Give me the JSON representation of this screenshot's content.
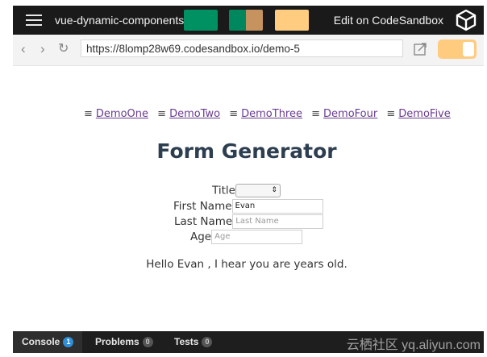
{
  "app": {
    "title": "vue-dynamic-components",
    "edit_link": "Edit on CodeSandbox",
    "swatch_colors": [
      "#009162",
      "#00875e",
      "#c6935f",
      "#ffcc80"
    ]
  },
  "browser": {
    "url": "https://8lomp28w69.codesandbox.io/demo-5"
  },
  "nav": {
    "items": [
      {
        "icon": "hamburger-icon",
        "label": "DemoOne"
      },
      {
        "icon": "hamburger-icon",
        "label": "DemoTwo"
      },
      {
        "icon": "hamburger-icon",
        "label": "DemoThree"
      },
      {
        "icon": "hamburger-icon",
        "label": "DemoFour"
      },
      {
        "icon": "hamburger-icon",
        "label": "DemoFive"
      }
    ]
  },
  "form": {
    "heading": "Form Generator",
    "title_label": "Title",
    "title_value": "",
    "first_name_label": "First Name",
    "first_name_value": "Evan",
    "last_name_label": "Last Name",
    "last_name_placeholder": "Last Name",
    "age_label": "Age",
    "age_placeholder": "Age"
  },
  "greeting": "Hello Evan , I hear you are years old.",
  "devtools": {
    "console_label": "Console",
    "console_count": "1",
    "problems_label": "Problems",
    "problems_count": "0",
    "tests_label": "Tests",
    "tests_count": "0"
  },
  "watermark": "云栖社区 yq.aliyun.com",
  "colors": {
    "topbar_bg": "#1a1a1a",
    "link": "#6a3c8f",
    "heading": "#2c3e50",
    "badge_blue": "#2f8fd8",
    "toggle_accent": "#ffcc7f"
  }
}
